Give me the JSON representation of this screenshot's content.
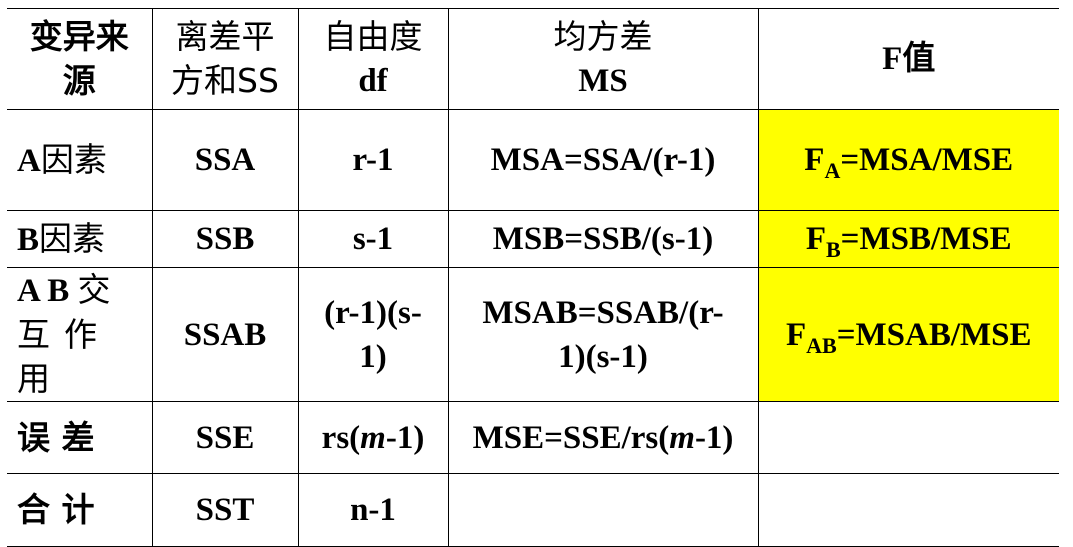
{
  "header": {
    "source_l1": "变异来",
    "source_l2": "源",
    "ss_l1": "离差平",
    "ss_l2": "方和SS",
    "df_l1": "自由度",
    "df_l2": "df",
    "ms_l1": "均方差",
    "ms_l2": "MS",
    "f": "F值"
  },
  "rows": [
    {
      "source_bold": "A",
      "source_cjk": "因素",
      "ss": "SSA",
      "df": "r-1",
      "ms": "MSA=SSA/(r-1)",
      "f_main": "F",
      "f_sub": "A",
      "f_rest": "=MSA/MSE"
    },
    {
      "source_bold": "B",
      "source_cjk": "因素",
      "ss": "SSB",
      "df": "s-1",
      "ms": "MSB=SSB/(s-1)",
      "f_main": "F",
      "f_sub": "B",
      "f_rest": "=MSB/MSE"
    },
    {
      "source_l1_bold": "A B",
      "source_l1_cjk": "交",
      "source_l2": "互作用",
      "ss": "SSAB",
      "df_l1": "(r-1)(s-",
      "df_l2": "1)",
      "ms_l1": "MSAB=SSAB/(r-",
      "ms_l2": "1)(s-1)",
      "f_main": "F",
      "f_sub": "AB",
      "f_rest": "=MSAB/MSE"
    },
    {
      "source": "误 差",
      "ss": "SSE",
      "df_pre": "rs(",
      "df_ital": "m",
      "df_post": "-1)",
      "ms_pre": "MSE=SSE/rs(",
      "ms_ital": "m",
      "ms_post": "-1)"
    },
    {
      "source": "合 计",
      "ss": "SST",
      "df": "n-1"
    }
  ],
  "colors": {
    "highlight": "#ffff00",
    "text": "#000000",
    "border": "#000000"
  }
}
